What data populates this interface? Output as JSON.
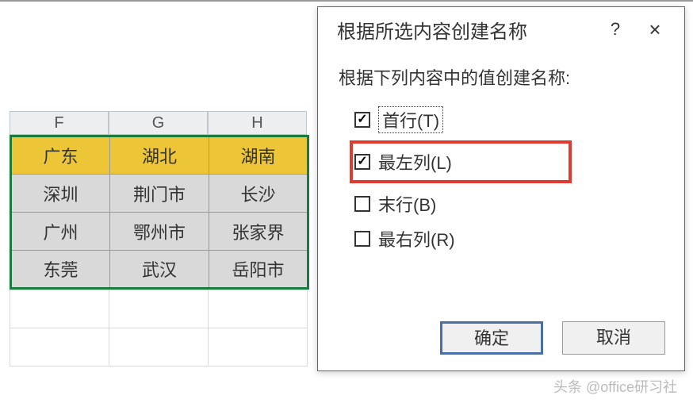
{
  "columns": {
    "F": "F",
    "G": "G",
    "H": "H"
  },
  "grid": {
    "headers": [
      "广东",
      "湖北",
      "湖南"
    ],
    "rows": [
      [
        "深圳",
        "荆门市",
        "长沙"
      ],
      [
        "广州",
        "鄂州市",
        "张家界"
      ],
      [
        "东莞",
        "武汉",
        "岳阳市"
      ]
    ]
  },
  "dialog": {
    "title": "根据所选内容创建名称",
    "help": "?",
    "close": "×",
    "prompt": "根据下列内容中的值创建名称:",
    "options": {
      "topRow": "首行(T)",
      "leftCol": "最左列(L)",
      "bottomRow": "末行(B)",
      "rightCol": "最右列(R)"
    },
    "ok": "确定",
    "cancel": "取消"
  },
  "watermark": "头条 @office研习社"
}
